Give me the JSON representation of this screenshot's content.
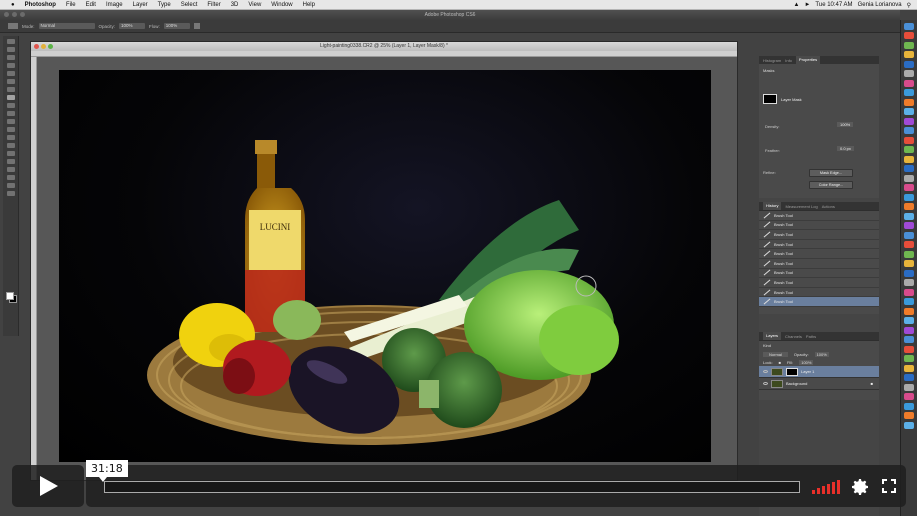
{
  "menubar": {
    "apple": "",
    "app": "Photoshop",
    "items": [
      "File",
      "Edit",
      "Image",
      "Layer",
      "Type",
      "Select",
      "Filter",
      "3D",
      "View",
      "Window",
      "Help"
    ],
    "clock": "Tue 10:47 AM",
    "user": "Genia Lorianova"
  },
  "window": {
    "title": "Adobe Photoshop CS6"
  },
  "options": {
    "mode_label": "Mode:",
    "mode_value": "Normal",
    "opacity_label": "Opacity:",
    "opacity_value": "100%",
    "flow_label": "Flow:",
    "flow_value": "100%"
  },
  "document": {
    "tab_title": "Light-painting0338.CR2 @ 25% (Layer 1, Layer Mask/8) *"
  },
  "canvas": {
    "label_text": "LUCINI"
  },
  "properties": {
    "tabs": [
      "Histogram",
      "Info",
      "Properties"
    ],
    "section": "Masks",
    "mask_label": "Layer Mask",
    "density_label": "Density:",
    "density_value": "100%",
    "feather_label": "Feather:",
    "feather_value": "0.0 px",
    "refine_label": "Refine:",
    "mask_edge_button": "Mask Edge...",
    "color_range_button": "Color Range..."
  },
  "history": {
    "tabs": [
      "History",
      "Measurement Log",
      "Actions"
    ],
    "items": [
      "Brush Tool",
      "Brush Tool",
      "Brush Tool",
      "Brush Tool",
      "Brush Tool",
      "Brush Tool",
      "Brush Tool",
      "Brush Tool",
      "Brush Tool",
      "Brush Tool"
    ],
    "selected_index": 9
  },
  "layers": {
    "tabs": [
      "Layers",
      "Channels",
      "Paths"
    ],
    "kind_label": "Kind",
    "blend_value": "Normal",
    "opacity_label": "Opacity:",
    "opacity_value": "100%",
    "lock_label": "Lock:",
    "fill_label": "Fill:",
    "fill_value": "100%",
    "rows": [
      {
        "name": "Layer 1",
        "selected": true
      },
      {
        "name": "Background",
        "selected": false
      }
    ]
  },
  "player": {
    "time": "31:18",
    "progress": 0.0,
    "volume_level": 0.8
  },
  "colors": {
    "accent": "#e8302a",
    "selection": "#6a7f9e",
    "panel": "#454545"
  }
}
